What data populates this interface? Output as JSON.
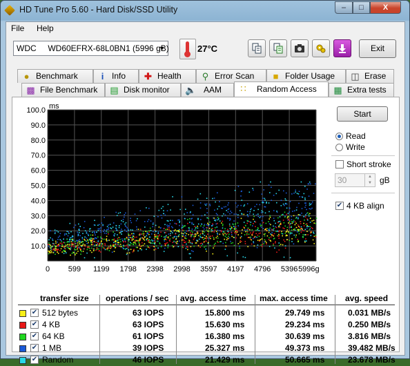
{
  "window": {
    "title": "HD Tune Pro 5.60 - Hard Disk/SSD Utility",
    "caption_min": "–",
    "caption_max": "□",
    "caption_close": "X"
  },
  "menu": [
    {
      "label": "File"
    },
    {
      "label": "Help"
    }
  ],
  "drive": {
    "selected": "WDC     WD60EFRX-68L0BN1 (5996 gB)"
  },
  "temperature": "27°C",
  "toolbar_icons": [
    "copy-icon",
    "copy-info-icon",
    "camera-icon",
    "options-icon",
    "download-icon"
  ],
  "exit_label": "Exit",
  "tabs_row1": [
    {
      "label": "Benchmark",
      "icon": "benchmark-icon"
    },
    {
      "label": "Info",
      "icon": "info-icon"
    },
    {
      "label": "Health",
      "icon": "health-icon"
    },
    {
      "label": "Error Scan",
      "icon": "error-scan-icon"
    },
    {
      "label": "Folder Usage",
      "icon": "folder-icon"
    },
    {
      "label": "Erase",
      "icon": "erase-icon"
    }
  ],
  "tabs_row2": [
    {
      "label": "File Benchmark",
      "icon": "file-benchmark-icon"
    },
    {
      "label": "Disk monitor",
      "icon": "disk-monitor-icon"
    },
    {
      "label": "AAM",
      "icon": "speaker-icon"
    },
    {
      "label": "Random Access",
      "icon": "random-access-icon",
      "active": true
    },
    {
      "label": "Extra tests",
      "icon": "extra-tests-icon"
    }
  ],
  "controls": {
    "start_label": "Start",
    "read_label": "Read",
    "write_label": "Write",
    "mode": "Read",
    "short_stroke_label": "Short stroke",
    "short_stroke_checked": false,
    "short_stroke_value": "30",
    "gb_label": "gB",
    "align_label": "4 KB align",
    "align_checked": true
  },
  "results": {
    "headers": [
      "transfer size",
      "operations / sec",
      "avg. access time",
      "max. access time",
      "avg. speed"
    ],
    "rows": [
      {
        "color": "#f8f018",
        "checked": true,
        "size": "512 bytes",
        "ops": "63 IOPS",
        "avg": "15.800 ms",
        "max": "29.749 ms",
        "speed": "0.031 MB/s"
      },
      {
        "color": "#e81818",
        "checked": true,
        "size": "4 KB",
        "ops": "63 IOPS",
        "avg": "15.630 ms",
        "max": "29.234 ms",
        "speed": "0.250 MB/s"
      },
      {
        "color": "#20d820",
        "checked": true,
        "size": "64 KB",
        "ops": "61 IOPS",
        "avg": "16.380 ms",
        "max": "30.639 ms",
        "speed": "3.816 MB/s"
      },
      {
        "color": "#1a5ad8",
        "checked": true,
        "size": "1 MB",
        "ops": "39 IOPS",
        "avg": "25.327 ms",
        "max": "49.373 ms",
        "speed": "39.482 MB/s"
      },
      {
        "color": "#28d8e8",
        "checked": true,
        "size": "Random",
        "ops": "46 IOPS",
        "avg": "21.429 ms",
        "max": "50.665 ms",
        "speed": "23.678 MB/s"
      }
    ]
  },
  "chart_data": {
    "type": "scatter",
    "ylabel": "ms",
    "ylim": [
      0,
      100
    ],
    "y_ticks": [
      "10.0",
      "20.0",
      "30.0",
      "40.0",
      "50.0",
      "60.0",
      "70.0",
      "80.0",
      "90.0",
      "100.0"
    ],
    "xlim": [
      0,
      5996
    ],
    "x_ticks": [
      "0",
      "599",
      "1199",
      "1798",
      "2398",
      "2998",
      "3597",
      "4197",
      "4796",
      "5396",
      "5996gB"
    ],
    "grid": true,
    "background": "#000000",
    "series": [
      {
        "name": "512 bytes",
        "color": "#f8f018",
        "avg": 15.8,
        "max": 29.749
      },
      {
        "name": "4 KB",
        "color": "#e81818",
        "avg": 15.63,
        "max": 29.234
      },
      {
        "name": "64 KB",
        "color": "#20d820",
        "avg": 16.38,
        "max": 30.639
      },
      {
        "name": "1 MB",
        "color": "#1a5ad8",
        "avg": 25.327,
        "max": 49.373
      },
      {
        "name": "Random",
        "color": "#28d8e8",
        "avg": 21.429,
        "max": 50.665
      }
    ]
  }
}
